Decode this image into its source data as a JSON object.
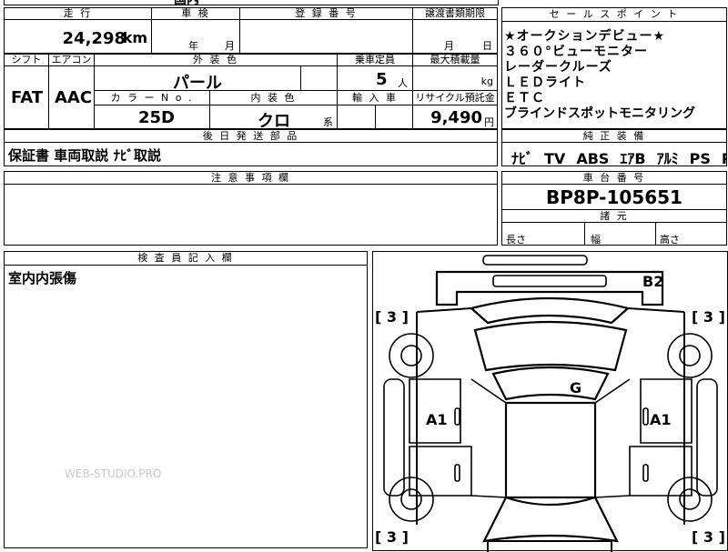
{
  "top_strip": {
    "partial_text": "国内"
  },
  "mileage": {
    "header": "走 行",
    "value": "24,298",
    "unit": "km"
  },
  "inspection": {
    "header": "車 検",
    "year_unit": "年",
    "month_unit": "月"
  },
  "registration": {
    "header": "登 録 番 号"
  },
  "transfer_deadline": {
    "header": "譲渡書類期限",
    "month_unit": "月",
    "day_unit": "日"
  },
  "shift": {
    "header": "シフト",
    "value": "FAT"
  },
  "aircon": {
    "header": "エアコン",
    "value": "AAC"
  },
  "exterior_color": {
    "header": "外 装 色",
    "value": "パール"
  },
  "capacity": {
    "header": "乗車定員",
    "value": "5",
    "unit": "人"
  },
  "max_load": {
    "header": "最大積載量",
    "unit": "kg"
  },
  "color_no": {
    "header": "カ ラ ー N o .",
    "value": "25D"
  },
  "interior_color": {
    "header": "内 装 色",
    "value": "クロ",
    "suffix": "系"
  },
  "import_car": {
    "header": "輸 入 車"
  },
  "recycle_fee": {
    "header": "リサイクル預託金",
    "value": "9,490",
    "unit": "円"
  },
  "sales_points": {
    "header": "セ ー ル ス ポ イ ン ト",
    "lines": [
      "★オークションデビュー★",
      "３６０°ビューモニター",
      "レーダークルーズ",
      "ＬＥＤライト",
      "ＥＴＣ",
      "ブラインドスポットモニタリング"
    ]
  },
  "later_parts": {
    "header": "後 日 発 送 部 品",
    "value": "保証書 車両取説 ﾅﾋﾞ取説"
  },
  "genuine_equipment": {
    "header": "純 正 装 備",
    "items": [
      "ﾅﾋﾞ",
      "TV",
      "ABS",
      "ｴｱB",
      "ｱﾙﾐ",
      "PS",
      "PW"
    ]
  },
  "notes": {
    "header": "注 意 事 項 欄"
  },
  "chassis": {
    "header": "車 台 番 号",
    "value": "BP8P-105651"
  },
  "specs": {
    "header": "諸 元",
    "length": "長さ",
    "width": "幅",
    "height": "高さ"
  },
  "inspector": {
    "header": "検 査 員 記 入 欄",
    "comment": "室内内張傷"
  },
  "watermark": "WEB-STUDIO.PRO",
  "diagram": {
    "marks": {
      "rear": "B2",
      "roof": "G",
      "left_side": "A1",
      "right_side": "A1"
    },
    "wheel_grades": [
      "[ 3 ]",
      "[ 3 ]",
      "[ 3 ]",
      "[ 3 ]"
    ]
  }
}
